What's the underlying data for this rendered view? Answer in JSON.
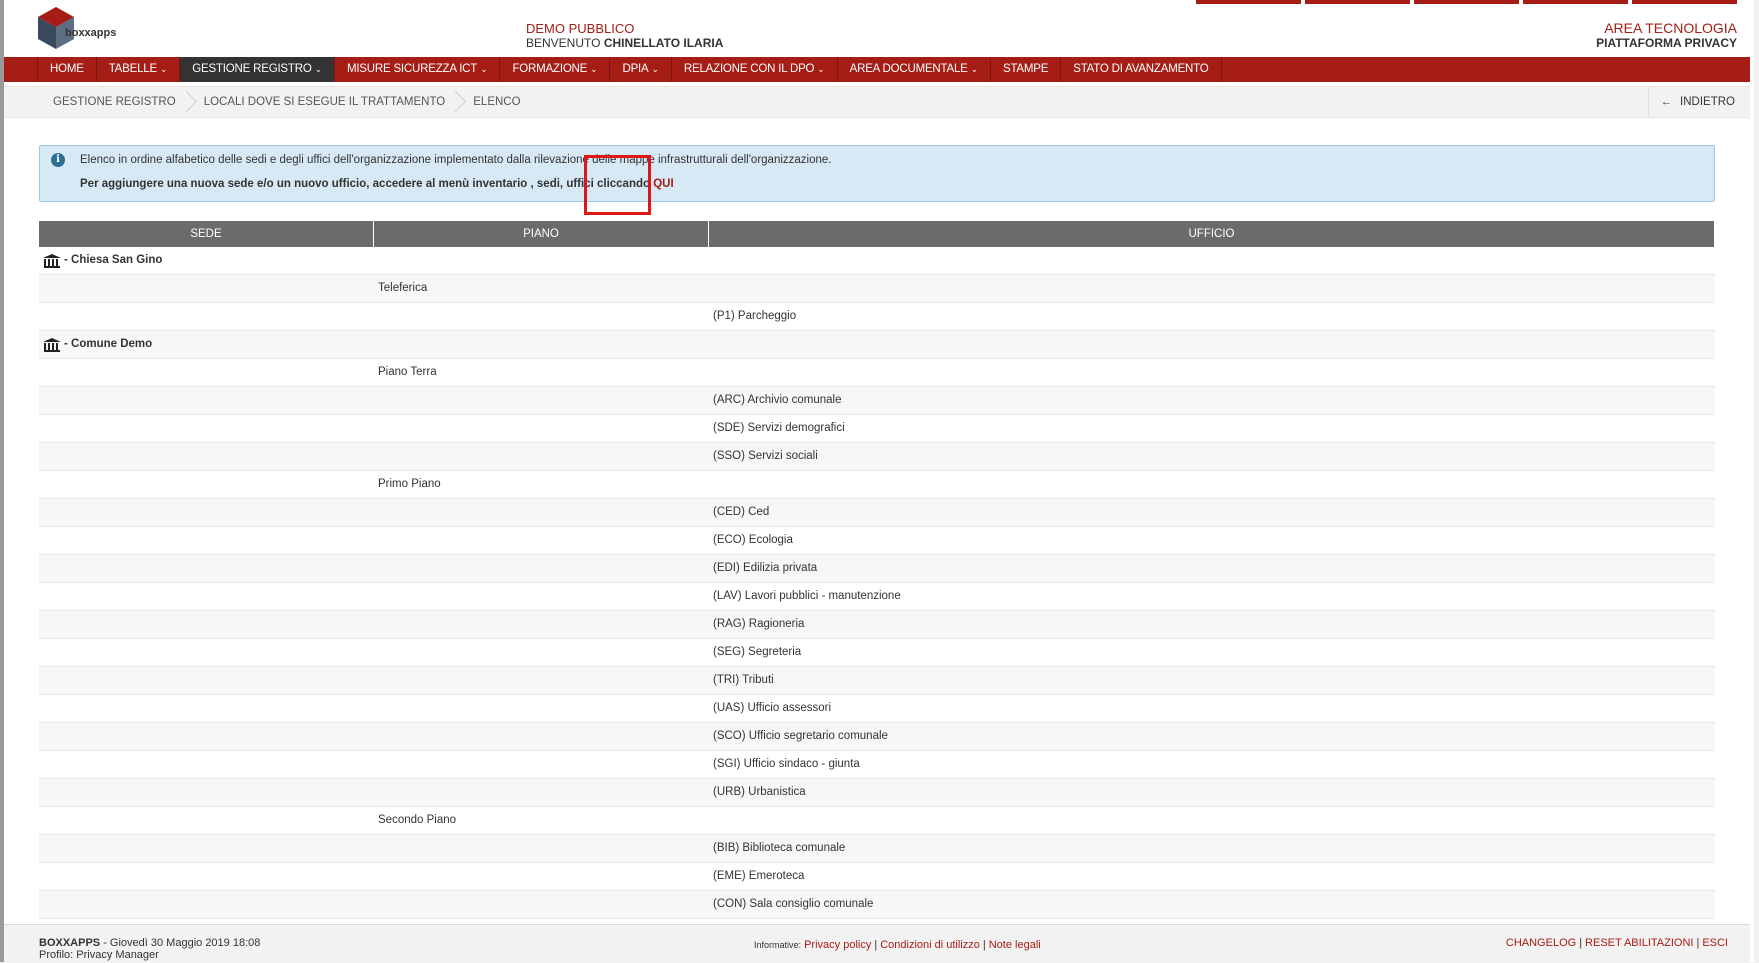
{
  "header": {
    "logo_text": "boxxapps",
    "ente": "DEMO PUBBLICO",
    "welcome_prefix": "BENVENUTO",
    "user": "CHINELLATO ILARIA",
    "area": "AREA TECNOLOGIA",
    "platform": "PIATTAFORMA PRIVACY"
  },
  "nav": [
    {
      "label": "HOME",
      "dropdown": false
    },
    {
      "label": "TABELLE",
      "dropdown": true
    },
    {
      "label": "GESTIONE REGISTRO",
      "dropdown": true,
      "active": true
    },
    {
      "label": "MISURE SICUREZZA ICT",
      "dropdown": true
    },
    {
      "label": "FORMAZIONE",
      "dropdown": true
    },
    {
      "label": "DPIA",
      "dropdown": true
    },
    {
      "label": "RELAZIONE CON IL DPO",
      "dropdown": true
    },
    {
      "label": "AREA DOCUMENTALE",
      "dropdown": true
    },
    {
      "label": "STAMPE",
      "dropdown": false
    },
    {
      "label": "STATO DI AVANZAMENTO",
      "dropdown": false
    }
  ],
  "breadcrumb": [
    "GESTIONE REGISTRO",
    "LOCALI DOVE SI ESEGUE IL TRATTAMENTO",
    "ELENCO"
  ],
  "back_label": "INDIETRO",
  "alert": {
    "line1": "Elenco in ordine alfabetico delle sedi e degli uffici dell'organizzazione implementato dalla rilevazione delle mappe infrastrutturali dell'organizzazione.",
    "line2": "Per aggiungere una nuova sede e/o un nuovo ufficio, accedere al menù inventario , sedi, uffici cliccando",
    "link": "QUI"
  },
  "table": {
    "headers": [
      "SEDE",
      "PIANO",
      "UFFICIO"
    ],
    "rows": [
      {
        "sede": "- Chiesa San Gino",
        "piano": "",
        "ufficio": ""
      },
      {
        "sede": "",
        "piano": "Teleferica",
        "ufficio": ""
      },
      {
        "sede": "",
        "piano": "",
        "ufficio": "(P1) Parcheggio"
      },
      {
        "sede": "- Comune Demo",
        "piano": "",
        "ufficio": ""
      },
      {
        "sede": "",
        "piano": "Piano Terra",
        "ufficio": ""
      },
      {
        "sede": "",
        "piano": "",
        "ufficio": "(ARC) Archivio comunale"
      },
      {
        "sede": "",
        "piano": "",
        "ufficio": "(SDE) Servizi demografici"
      },
      {
        "sede": "",
        "piano": "",
        "ufficio": "(SSO) Servizi sociali"
      },
      {
        "sede": "",
        "piano": "Primo Piano",
        "ufficio": ""
      },
      {
        "sede": "",
        "piano": "",
        "ufficio": "(CED) Ced"
      },
      {
        "sede": "",
        "piano": "",
        "ufficio": "(ECO) Ecologia"
      },
      {
        "sede": "",
        "piano": "",
        "ufficio": "(EDI) Edilizia privata"
      },
      {
        "sede": "",
        "piano": "",
        "ufficio": "(LAV) Lavori pubblici - manutenzione"
      },
      {
        "sede": "",
        "piano": "",
        "ufficio": "(RAG) Ragioneria"
      },
      {
        "sede": "",
        "piano": "",
        "ufficio": "(SEG) Segreteria"
      },
      {
        "sede": "",
        "piano": "",
        "ufficio": "(TRI) Tributi"
      },
      {
        "sede": "",
        "piano": "",
        "ufficio": "(UAS) Ufficio assessori"
      },
      {
        "sede": "",
        "piano": "",
        "ufficio": "(SCO) Ufficio segretario comunale"
      },
      {
        "sede": "",
        "piano": "",
        "ufficio": "(SGI) Ufficio sindaco - giunta"
      },
      {
        "sede": "",
        "piano": "",
        "ufficio": "(URB) Urbanistica"
      },
      {
        "sede": "",
        "piano": "Secondo Piano",
        "ufficio": ""
      },
      {
        "sede": "",
        "piano": "",
        "ufficio": "(BIB) Biblioteca comunale"
      },
      {
        "sede": "",
        "piano": "",
        "ufficio": "(EME) Emeroteca"
      },
      {
        "sede": "",
        "piano": "",
        "ufficio": "(CON) Sala consiglio comunale"
      }
    ]
  },
  "footer": {
    "app": "BOXXAPPS",
    "date": "- Giovedì 30 Maggio 2019 18:08",
    "profile": "Profilo: Privacy Manager",
    "info_label": "Informative:",
    "links": [
      "Privacy policy",
      "Condizioni di utilizzo",
      "Note legali"
    ],
    "right_links": [
      "CHANGELOG",
      "RESET ABILITAZIONI",
      "ESCI"
    ]
  },
  "colors": {
    "brand": "#a51d14",
    "active_nav": "#333333",
    "header_cell": "#6b6b6b",
    "alert_bg": "#d6e9f5"
  }
}
